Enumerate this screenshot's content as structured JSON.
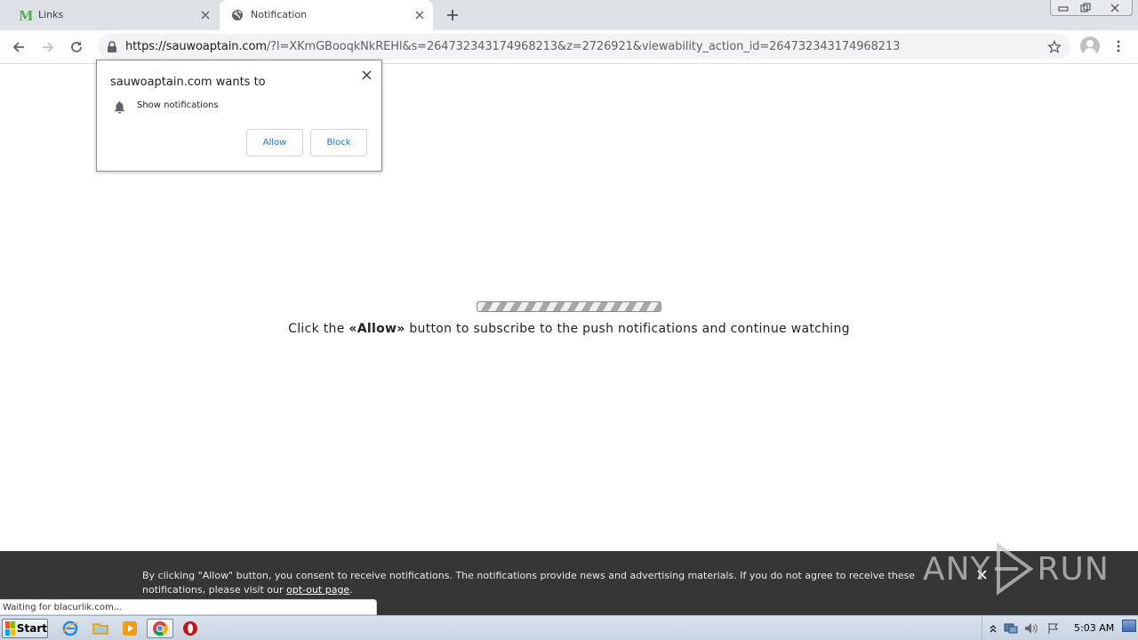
{
  "browser": {
    "tabs": [
      {
        "title": "Links",
        "active": false
      },
      {
        "title": "Notification",
        "active": true
      }
    ],
    "url_host": "https://sauwoaptain.com",
    "url_rest": "/?l=XKmGBooqkNkREHl&s=264732343174968213&z=2726921&viewability_action_id=264732343174968213"
  },
  "permission_popup": {
    "title": "sauwoaptain.com wants to",
    "request": "Show notifications",
    "allow_label": "Allow",
    "block_label": "Block"
  },
  "page": {
    "message_before": "Click the ",
    "message_bold": "«Allow»",
    "message_after": " button to subscribe to the push notifications and continue watching"
  },
  "consent_bar": {
    "text": "By clicking \"Allow\" button, you consent to receive notifications. The notifications provide news and advertising materials. If you do not agree to receive these notifications, please visit our ",
    "link_text": "opt-out page",
    "text_end": "."
  },
  "watermark": {
    "left_text": "ANY",
    "right_text": "RUN"
  },
  "status_bar": {
    "text": "Waiting for blacurlik.com..."
  },
  "taskbar": {
    "start_label": "Start",
    "clock": "5:03 AM"
  },
  "colors": {
    "tab_strip": "#dee1e6",
    "link_blue": "#1a73e8",
    "consent_bg": "#363636"
  }
}
